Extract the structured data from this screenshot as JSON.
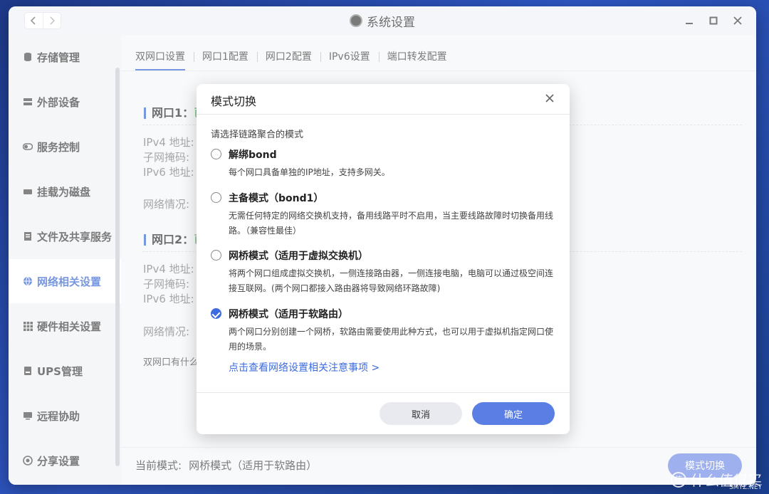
{
  "window": {
    "title": "系统设置"
  },
  "sidebar": {
    "items": [
      {
        "label": "存储管理",
        "icon": "database-icon"
      },
      {
        "label": "外部设备",
        "icon": "device-icon"
      },
      {
        "label": "服务控制",
        "icon": "toggle-icon"
      },
      {
        "label": "挂载为磁盘",
        "icon": "disk-icon"
      },
      {
        "label": "文件及共享服务",
        "icon": "file-share-icon"
      },
      {
        "label": "网络相关设置",
        "icon": "globe-icon",
        "active": true
      },
      {
        "label": "硬件相关设置",
        "icon": "grid-icon"
      },
      {
        "label": "UPS管理",
        "icon": "ups-icon"
      },
      {
        "label": "远程协助",
        "icon": "remote-icon"
      },
      {
        "label": "分享设置",
        "icon": "share-icon"
      }
    ]
  },
  "tabs": [
    "双网口设置",
    "网口1配置",
    "网口2配置",
    "IPv6设置",
    "端口转发配置"
  ],
  "port1": {
    "title": "网口1：",
    "status": "已",
    "ipv4": "IPv4 地址:",
    "mask": "子网掩码:",
    "ipv6": "IPv6 地址:",
    "net": "网络情况:"
  },
  "port2": {
    "title": "网口2：",
    "status": "已",
    "ipv4": "IPv4 地址:",
    "mask": "子网掩码:",
    "ipv6": "IPv6 地址:",
    "net": "网络情况:"
  },
  "note": "双网口有什么",
  "bottom": {
    "current_label": "当前模式:",
    "current_value": "网桥模式（适用于软路由）",
    "switch_button": "模式切换"
  },
  "modal": {
    "title": "模式切换",
    "prompt": "请选择链路聚合的模式",
    "options": [
      {
        "label": "解绑bond",
        "desc": "每个网口具备单独的IP地址，支持多网关。",
        "checked": false
      },
      {
        "label": "主备模式（bond1）",
        "desc": "无需任何特定的网络交换机支持，备用线路平时不启用，当主要线路故障时切换备用线路。（兼容性最佳）",
        "checked": false
      },
      {
        "label": "网桥模式（适用于虚拟交换机）",
        "desc": "将两个网口组成虚拟交换机，一侧连接路由器，一侧连接电脑，电脑可以通过极空间连接互联网。(两个网口都接入路由器将导致网络环路故障)",
        "checked": false
      },
      {
        "label": "网桥模式（适用于软路由）",
        "desc": "两个网口分别创建一个网桥，软路由需要使用此种方式，也可以用于虚拟机指定网口使用的场景。",
        "checked": true
      }
    ],
    "link": "点击查看网络设置相关注意事项 >",
    "cancel": "取消",
    "ok": "确定"
  },
  "watermark": {
    "text": "什么值得买",
    "sub": "SMYZ.NET"
  },
  "colors": {
    "accent": "#2f5fd0",
    "primary_button": "#5b7ee5",
    "status_green": "#4caf50"
  }
}
